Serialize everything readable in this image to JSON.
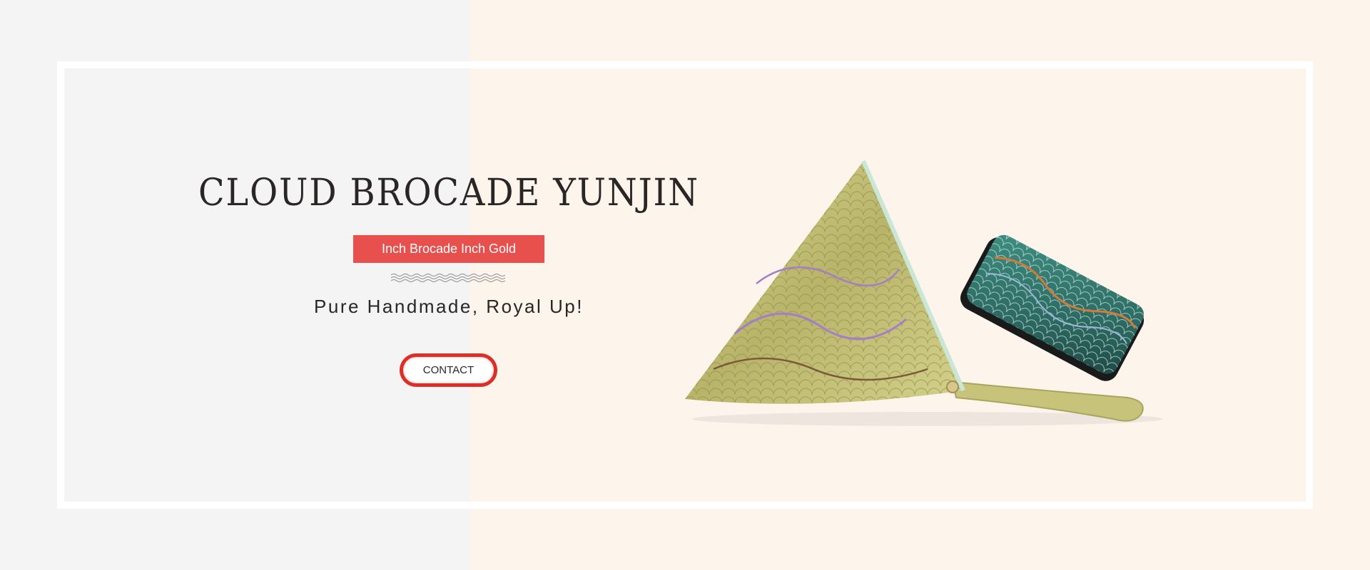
{
  "colors": {
    "left_background": "#f4f4f4",
    "right_background": "#fdf4ec",
    "frame": "#ffffff",
    "accent_red": "#e8504e",
    "button_border": "#d9302a",
    "text_dark": "#2a2626"
  },
  "banner": {
    "title": "CLOUD BROCADE YUNJIN",
    "tag": "Inch Brocade Inch Gold",
    "subtitle": "Pure Handmade, Royal Up!",
    "contact_label": "CONTACT"
  },
  "icons": {
    "divider": "wave-divider-icon",
    "product": "brocade-pouch-and-wallet-image"
  }
}
